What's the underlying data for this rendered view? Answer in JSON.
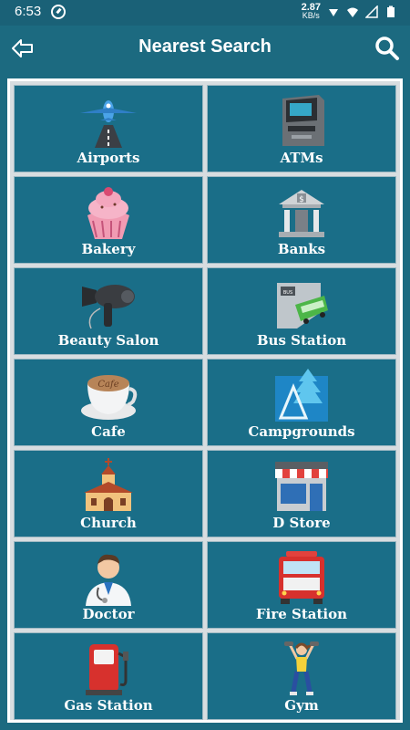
{
  "status": {
    "time": "6:53",
    "net_speed_value": "2.87",
    "net_speed_unit": "KB/s"
  },
  "header": {
    "title": "Nearest Search",
    "back_icon": "arrow-back-icon",
    "search_icon": "search-icon"
  },
  "colors": {
    "primary": "#1c6a80",
    "tile": "#1a6e88",
    "frame": "#d8dde0"
  },
  "categories": [
    {
      "label": "Airports",
      "icon": "airplane-icon"
    },
    {
      "label": "ATMs",
      "icon": "atm-machine-icon"
    },
    {
      "label": "Bakery",
      "icon": "cupcake-icon"
    },
    {
      "label": "Banks",
      "icon": "bank-building-icon"
    },
    {
      "label": "Beauty Salon",
      "icon": "hair-dryer-icon"
    },
    {
      "label": "Bus Station",
      "icon": "bus-stop-icon"
    },
    {
      "label": "Cafe",
      "icon": "coffee-cup-icon"
    },
    {
      "label": "Campgrounds",
      "icon": "camping-tent-icon"
    },
    {
      "label": "Church",
      "icon": "church-icon"
    },
    {
      "label": "D Store",
      "icon": "store-front-icon"
    },
    {
      "label": "Doctor",
      "icon": "doctor-icon"
    },
    {
      "label": "Fire Station",
      "icon": "fire-truck-icon"
    },
    {
      "label": "Gas Station",
      "icon": "gas-pump-icon"
    },
    {
      "label": "Gym",
      "icon": "fitness-woman-icon"
    }
  ]
}
